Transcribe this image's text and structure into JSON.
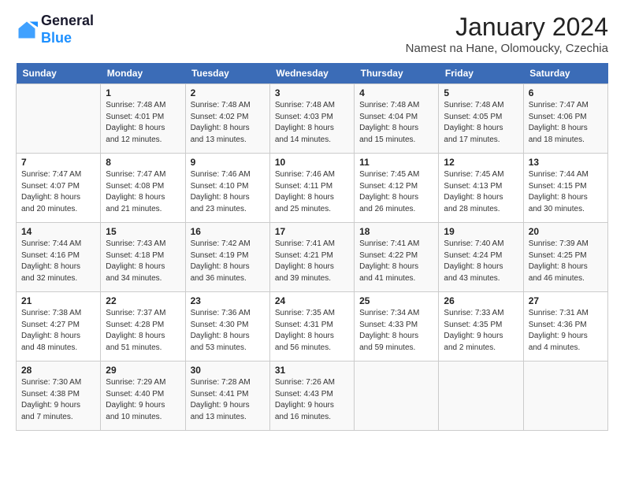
{
  "logo": {
    "line1": "General",
    "line2": "Blue"
  },
  "title": "January 2024",
  "subtitle": "Namest na Hane, Olomoucky, Czechia",
  "headers": [
    "Sunday",
    "Monday",
    "Tuesday",
    "Wednesday",
    "Thursday",
    "Friday",
    "Saturday"
  ],
  "weeks": [
    [
      {
        "day": "",
        "info": ""
      },
      {
        "day": "1",
        "info": "Sunrise: 7:48 AM\nSunset: 4:01 PM\nDaylight: 8 hours\nand 12 minutes."
      },
      {
        "day": "2",
        "info": "Sunrise: 7:48 AM\nSunset: 4:02 PM\nDaylight: 8 hours\nand 13 minutes."
      },
      {
        "day": "3",
        "info": "Sunrise: 7:48 AM\nSunset: 4:03 PM\nDaylight: 8 hours\nand 14 minutes."
      },
      {
        "day": "4",
        "info": "Sunrise: 7:48 AM\nSunset: 4:04 PM\nDaylight: 8 hours\nand 15 minutes."
      },
      {
        "day": "5",
        "info": "Sunrise: 7:48 AM\nSunset: 4:05 PM\nDaylight: 8 hours\nand 17 minutes."
      },
      {
        "day": "6",
        "info": "Sunrise: 7:47 AM\nSunset: 4:06 PM\nDaylight: 8 hours\nand 18 minutes."
      }
    ],
    [
      {
        "day": "7",
        "info": "Sunrise: 7:47 AM\nSunset: 4:07 PM\nDaylight: 8 hours\nand 20 minutes."
      },
      {
        "day": "8",
        "info": "Sunrise: 7:47 AM\nSunset: 4:08 PM\nDaylight: 8 hours\nand 21 minutes."
      },
      {
        "day": "9",
        "info": "Sunrise: 7:46 AM\nSunset: 4:10 PM\nDaylight: 8 hours\nand 23 minutes."
      },
      {
        "day": "10",
        "info": "Sunrise: 7:46 AM\nSunset: 4:11 PM\nDaylight: 8 hours\nand 25 minutes."
      },
      {
        "day": "11",
        "info": "Sunrise: 7:45 AM\nSunset: 4:12 PM\nDaylight: 8 hours\nand 26 minutes."
      },
      {
        "day": "12",
        "info": "Sunrise: 7:45 AM\nSunset: 4:13 PM\nDaylight: 8 hours\nand 28 minutes."
      },
      {
        "day": "13",
        "info": "Sunrise: 7:44 AM\nSunset: 4:15 PM\nDaylight: 8 hours\nand 30 minutes."
      }
    ],
    [
      {
        "day": "14",
        "info": "Sunrise: 7:44 AM\nSunset: 4:16 PM\nDaylight: 8 hours\nand 32 minutes."
      },
      {
        "day": "15",
        "info": "Sunrise: 7:43 AM\nSunset: 4:18 PM\nDaylight: 8 hours\nand 34 minutes."
      },
      {
        "day": "16",
        "info": "Sunrise: 7:42 AM\nSunset: 4:19 PM\nDaylight: 8 hours\nand 36 minutes."
      },
      {
        "day": "17",
        "info": "Sunrise: 7:41 AM\nSunset: 4:21 PM\nDaylight: 8 hours\nand 39 minutes."
      },
      {
        "day": "18",
        "info": "Sunrise: 7:41 AM\nSunset: 4:22 PM\nDaylight: 8 hours\nand 41 minutes."
      },
      {
        "day": "19",
        "info": "Sunrise: 7:40 AM\nSunset: 4:24 PM\nDaylight: 8 hours\nand 43 minutes."
      },
      {
        "day": "20",
        "info": "Sunrise: 7:39 AM\nSunset: 4:25 PM\nDaylight: 8 hours\nand 46 minutes."
      }
    ],
    [
      {
        "day": "21",
        "info": "Sunrise: 7:38 AM\nSunset: 4:27 PM\nDaylight: 8 hours\nand 48 minutes."
      },
      {
        "day": "22",
        "info": "Sunrise: 7:37 AM\nSunset: 4:28 PM\nDaylight: 8 hours\nand 51 minutes."
      },
      {
        "day": "23",
        "info": "Sunrise: 7:36 AM\nSunset: 4:30 PM\nDaylight: 8 hours\nand 53 minutes."
      },
      {
        "day": "24",
        "info": "Sunrise: 7:35 AM\nSunset: 4:31 PM\nDaylight: 8 hours\nand 56 minutes."
      },
      {
        "day": "25",
        "info": "Sunrise: 7:34 AM\nSunset: 4:33 PM\nDaylight: 8 hours\nand 59 minutes."
      },
      {
        "day": "26",
        "info": "Sunrise: 7:33 AM\nSunset: 4:35 PM\nDaylight: 9 hours\nand 2 minutes."
      },
      {
        "day": "27",
        "info": "Sunrise: 7:31 AM\nSunset: 4:36 PM\nDaylight: 9 hours\nand 4 minutes."
      }
    ],
    [
      {
        "day": "28",
        "info": "Sunrise: 7:30 AM\nSunset: 4:38 PM\nDaylight: 9 hours\nand 7 minutes."
      },
      {
        "day": "29",
        "info": "Sunrise: 7:29 AM\nSunset: 4:40 PM\nDaylight: 9 hours\nand 10 minutes."
      },
      {
        "day": "30",
        "info": "Sunrise: 7:28 AM\nSunset: 4:41 PM\nDaylight: 9 hours\nand 13 minutes."
      },
      {
        "day": "31",
        "info": "Sunrise: 7:26 AM\nSunset: 4:43 PM\nDaylight: 9 hours\nand 16 minutes."
      },
      {
        "day": "",
        "info": ""
      },
      {
        "day": "",
        "info": ""
      },
      {
        "day": "",
        "info": ""
      }
    ]
  ]
}
